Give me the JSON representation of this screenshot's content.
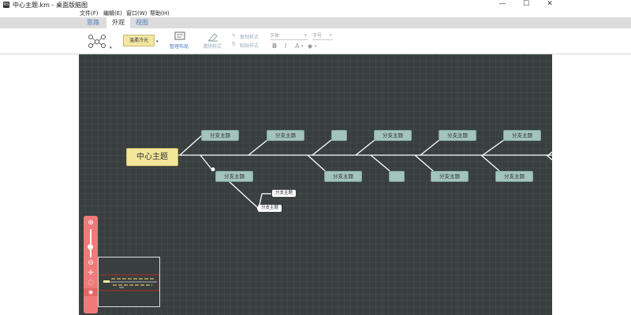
{
  "window": {
    "title": "中心主题.km - 桌面版脑图",
    "icon_text": "RS",
    "controls": [
      "—",
      "☐",
      "✕"
    ]
  },
  "menubar": {
    "items": [
      "文件(F)",
      "编辑(E)",
      "窗口(W)",
      "帮助(H)"
    ]
  },
  "tabs": [
    "思路",
    "外观",
    "视图"
  ],
  "active_tab": "外观",
  "toolbar": {
    "template_icon": "structure-icon",
    "theme_value": "温柔冷光",
    "arrange_label": "整理布局",
    "clear_style_label": "清除样式",
    "copy_style_label": "复制样式",
    "paste_style_label": "粘贴样式",
    "font_placeholder": "字体",
    "size_placeholder": "字号",
    "bold": "B",
    "italic": "I",
    "font_color": "A",
    "bg_color": "◆"
  },
  "mindmap": {
    "central": "中心主题",
    "branches_top": [
      "分支主题",
      "分支主题",
      "",
      "分支主题",
      "分支主题",
      "分支主题"
    ],
    "branches_bottom": [
      "分支主题",
      "分支主题",
      "",
      "分支主题",
      "分支主题"
    ],
    "leaves": [
      "分支主题",
      "分支主题"
    ]
  },
  "colors": {
    "canvas_bg": "#393f3f",
    "central_fill": "#f3e79a",
    "branch_fill": "#a3c4bd",
    "zoom_panel": "#f07a7a"
  }
}
